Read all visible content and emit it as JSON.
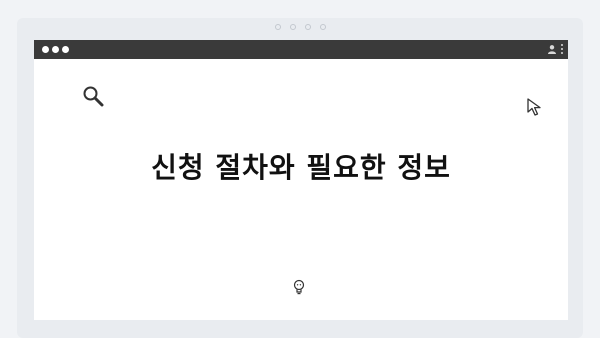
{
  "window": {
    "headline": "신청 절차와 필요한 정보"
  },
  "icons": {
    "titlebar_controls": "traffic-light-dots",
    "account": "user-icon",
    "menu": "kebab-menu-icon",
    "search": "search-icon",
    "pointer": "cursor-arrow-icon",
    "bulb": "lightbulb-icon"
  },
  "colors": {
    "page_background": "#f1f3f6",
    "titlebar": "#3a3a3a",
    "window_background": "#ffffff",
    "headline_text": "#111111"
  }
}
